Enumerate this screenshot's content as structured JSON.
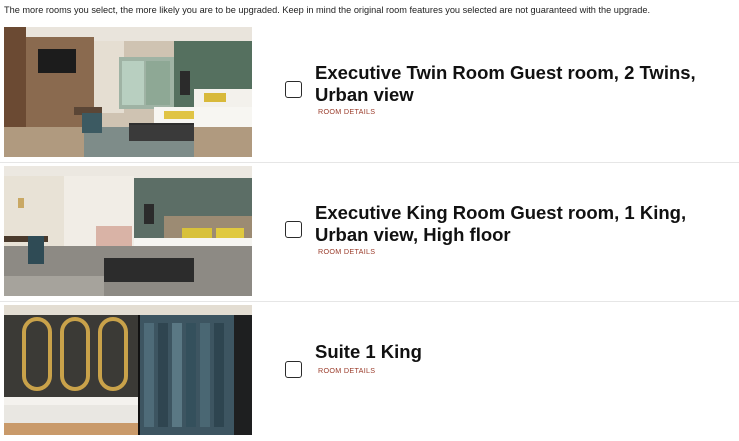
{
  "intro_text": "The more rooms you select, the more likely you are to be upgraded. Keep in mind the original room features you selected are not guaranteed with the upgrade.",
  "rooms": [
    {
      "title": "Executive Twin Room Guest room, 2 Twins, Urban view",
      "details_label": "ROOM DETAILS",
      "selected": false,
      "image_icon": "twin-bedroom-photo"
    },
    {
      "title": "Executive King Room Guest room, 1 King, Urban view, High floor",
      "details_label": "ROOM DETAILS",
      "selected": false,
      "image_icon": "king-bedroom-photo"
    },
    {
      "title": "Suite 1 King",
      "details_label": "ROOM DETAILS",
      "selected": false,
      "image_icon": "suite-bathroom-photo"
    }
  ],
  "colors": {
    "details_link": "#9a3b2a",
    "checkbox_border": "#2b2b2b",
    "divider": "#e6e6e6"
  }
}
